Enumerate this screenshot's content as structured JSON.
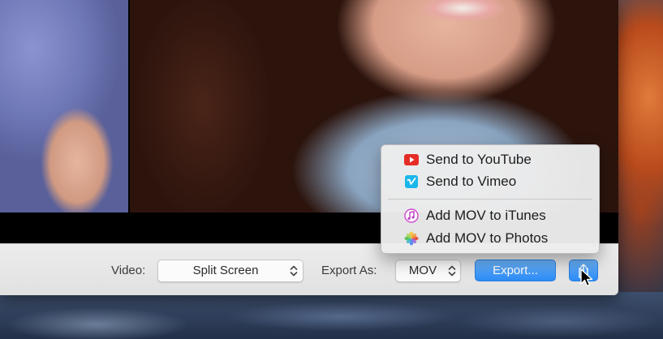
{
  "toolbar": {
    "video_label": "Video:",
    "video_value": "Split Screen",
    "export_as_label": "Export As:",
    "export_as_value": "MOV",
    "export_button": "Export..."
  },
  "share_menu": {
    "items": [
      {
        "label": "Send to YouTube",
        "icon": "youtube-icon"
      },
      {
        "label": "Send to Vimeo",
        "icon": "vimeo-icon"
      },
      {
        "label": "Add MOV to iTunes",
        "icon": "itunes-icon"
      },
      {
        "label": "Add MOV to Photos",
        "icon": "photos-icon"
      }
    ]
  },
  "colors": {
    "accent_blue": "#2c8cf6",
    "youtube_red": "#e52d27",
    "vimeo_blue": "#1ab7ea"
  },
  "icons": {
    "share_button": "share-icon",
    "popup_arrows": "up-down-arrows-icon",
    "pointer": "mouse-cursor-icon"
  }
}
